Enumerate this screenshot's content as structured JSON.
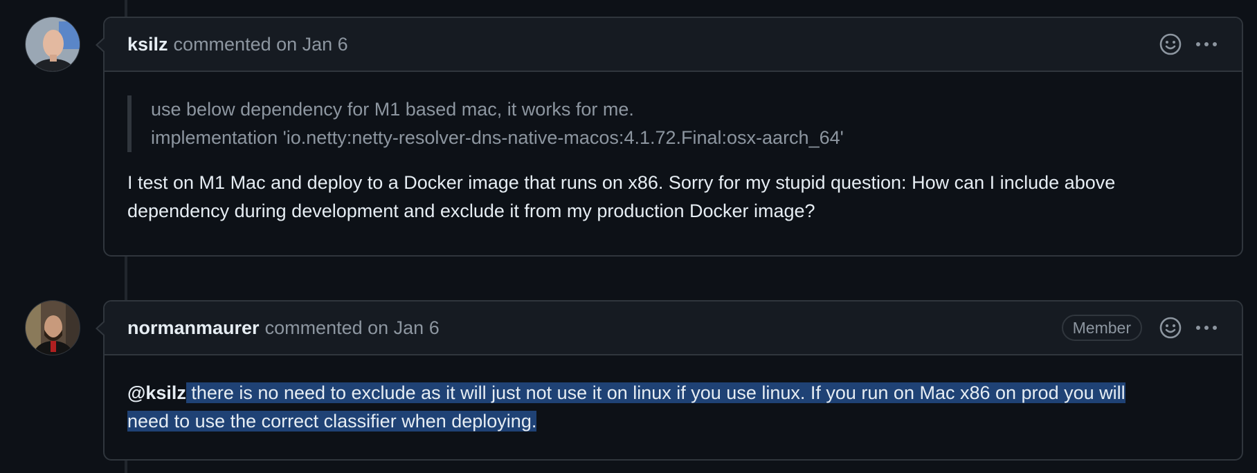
{
  "comments": [
    {
      "author": "ksilz",
      "meta": "commented on Jan 6",
      "quote": [
        "use below dependency for M1 based mac, it works for me.",
        "implementation 'io.netty:netty-resolver-dns-native-macos:4.1.72.Final:osx-aarch_64'"
      ],
      "body": [
        "I test on M1 Mac and deploy to a Docker image that runs on x86. Sorry for my stupid question: How can I include above",
        "dependency during development and exclude it from my production Docker image?"
      ]
    },
    {
      "author": "normanmaurer",
      "meta": "commented on Jan 6",
      "badge": "Member",
      "mention": "@ksilz",
      "body": [
        " there is no need to exclude as it will just not use it on linux if you use linux. If you run on Mac x86 on prod you will",
        "need to use the correct classifier when deploying."
      ]
    }
  ],
  "icons": {
    "reaction": "smiley-icon",
    "more": "kebab-horizontal-icon"
  },
  "colors": {
    "background": "#0d1117",
    "header_bg": "#161b22",
    "border": "#30363d",
    "muted_text": "#8d96a0",
    "text": "#e6edf3",
    "selection": "#1f4275"
  }
}
